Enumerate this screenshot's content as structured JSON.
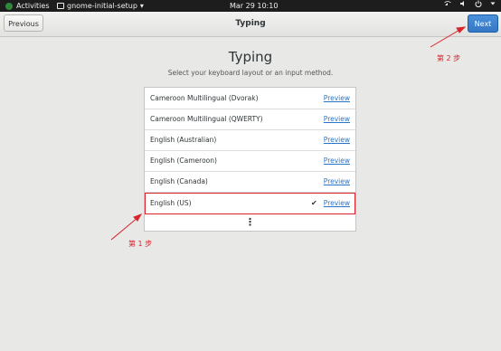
{
  "topbar": {
    "activities": "Activities",
    "app_name": "gnome-initial-setup",
    "clock": "Mar 29  10:10",
    "icons": [
      "network-icon",
      "volume-icon",
      "power-icon",
      "menu-down-icon"
    ]
  },
  "header": {
    "previous": "Previous",
    "title": "Typing",
    "next": "Next"
  },
  "main": {
    "title": "Typing",
    "subtitle": "Select your keyboard layout or an input method.",
    "layouts": [
      {
        "name": "Cameroon Multilingual (Dvorak)",
        "preview": "Preview",
        "selected": false
      },
      {
        "name": "Cameroon Multilingual (QWERTY)",
        "preview": "Preview",
        "selected": false
      },
      {
        "name": "English (Australian)",
        "preview": "Preview",
        "selected": false
      },
      {
        "name": "English (Cameroon)",
        "preview": "Preview",
        "selected": false
      },
      {
        "name": "English (Canada)",
        "preview": "Preview",
        "selected": false
      },
      {
        "name": "English (US)",
        "preview": "Preview",
        "selected": true,
        "check": "✔"
      }
    ],
    "more": "⋮"
  },
  "annotations": {
    "step1": "第 1 步",
    "step2": "第 2 步",
    "color": "#d8242c"
  },
  "colors": {
    "accent": "#3478c6",
    "link": "#2a76c6"
  }
}
